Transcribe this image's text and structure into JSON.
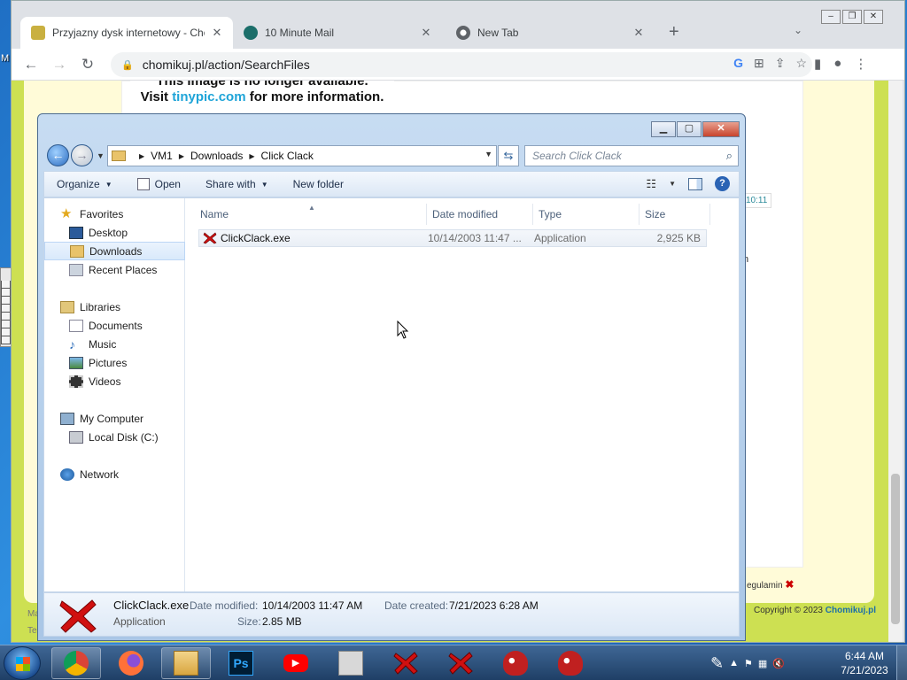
{
  "desktop": {
    "edge_letter": "M"
  },
  "chrome": {
    "tabs": [
      {
        "title": "Przyjazny dysk internetowy - Chomikuj.pl",
        "active": true
      },
      {
        "title": "10 Minute Mail",
        "active": false
      },
      {
        "title": "New Tab",
        "active": false
      }
    ],
    "new_tab": "+",
    "tab_list": "⌄",
    "url": "chomikuj.pl/action/SearchFiles"
  },
  "webpage": {
    "tinypic_line1": "This image is no longer available.",
    "tinypic_visit": "Visit ",
    "tinypic_link": "tinypic.com",
    "tinypic_rest": " for more information.",
    "time_tag": "10:11",
    "edge_n": "n",
    "regulamin": "egulamin",
    "copyright": "Copyright © 2023 ",
    "copyright_brand": "Chomikuj.pl",
    "left_ma": "Ma",
    "left_te": "Te"
  },
  "explorer": {
    "breadcrumb": [
      "VM1",
      "Downloads",
      "Click Clack"
    ],
    "search_placeholder": "Search Click Clack",
    "commands": {
      "organize": "Organize",
      "open": "Open",
      "share_with": "Share with",
      "new_folder": "New folder"
    },
    "nav": {
      "favorites": "Favorites",
      "desktop": "Desktop",
      "downloads": "Downloads",
      "recent": "Recent Places",
      "libraries": "Libraries",
      "documents": "Documents",
      "music": "Music",
      "pictures": "Pictures",
      "videos": "Videos",
      "computer": "My Computer",
      "local_disk": "Local Disk (C:)",
      "network": "Network"
    },
    "columns": {
      "name": "Name",
      "date": "Date modified",
      "type": "Type",
      "size": "Size"
    },
    "files": [
      {
        "name": "ClickClack.exe",
        "date": "10/14/2003 11:47 ...",
        "type": "Application",
        "size": "2,925 KB"
      }
    ],
    "details": {
      "name": "ClickClack.exe",
      "type": "Application",
      "date_modified_label": "Date modified:",
      "date_modified": "10/14/2003 11:47 AM",
      "date_created_label": "Date created:",
      "date_created": "7/21/2023 6:28 AM",
      "size_label": "Size:",
      "size": "2.85 MB"
    }
  },
  "taskbar": {
    "clock_time": "6:44 AM",
    "clock_date": "7/21/2023"
  },
  "colors": {
    "page_green": "#cde052",
    "link_blue": "#1ea4d8",
    "brand_blue": "#1d6fa8",
    "red_x": "#d01010"
  }
}
